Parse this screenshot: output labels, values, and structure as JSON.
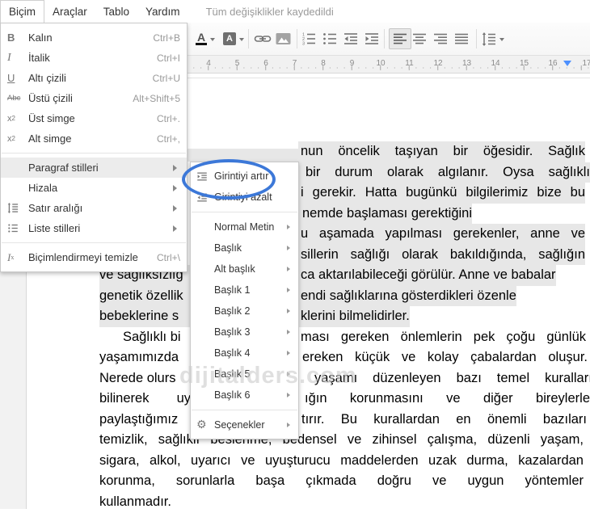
{
  "menubar": {
    "items": [
      {
        "label": "Biçim",
        "state": "open"
      },
      {
        "label": "Araçlar",
        "state": "closed"
      },
      {
        "label": "Tablo",
        "state": "closed"
      },
      {
        "label": "Yardım",
        "state": "closed"
      }
    ],
    "status": "Tüm değişiklikler kaydedildi"
  },
  "toolbar": {
    "text_color_letter": "A",
    "highlight_letter": "A",
    "icons": [
      "text-color-icon",
      "highlight-color-icon",
      "link-icon",
      "image-icon",
      "numbered-list-icon",
      "bulleted-list-icon",
      "decrease-indent-icon",
      "increase-indent-icon",
      "align-left-icon",
      "align-center-icon",
      "align-right-icon",
      "justify-icon",
      "line-spacing-icon"
    ],
    "active_button": "align-left"
  },
  "ruler": {
    "numbers": [
      "4",
      "5",
      "6",
      "7",
      "8",
      "9",
      "10",
      "11",
      "12",
      "13",
      "14",
      "15",
      "16",
      "17"
    ],
    "marker_color": "#4d90fe"
  },
  "format_menu": {
    "items": [
      {
        "label": "Kalın",
        "shortcut": "Ctrl+B",
        "icon": "bold-icon",
        "icon_glyph": "B"
      },
      {
        "label": "İtalik",
        "shortcut": "Ctrl+I",
        "icon": "italic-icon",
        "icon_glyph": "I"
      },
      {
        "label": "Altı çizili",
        "shortcut": "Ctrl+U",
        "icon": "underline-icon",
        "icon_glyph": "U"
      },
      {
        "label": "Üstü çizili",
        "shortcut": "Alt+Shift+5",
        "icon": "strikethrough-icon",
        "icon_glyph": "Abc"
      },
      {
        "label": "Üst simge",
        "shortcut": "Ctrl+.",
        "icon": "superscript-icon",
        "icon_glyph": "x"
      },
      {
        "label": "Alt simge",
        "shortcut": "Ctrl+,",
        "icon": "subscript-icon",
        "icon_glyph": "x"
      },
      {
        "label": "Paragraf stilleri",
        "has_submenu": true,
        "highlighted": true
      },
      {
        "label": "Hizala",
        "has_submenu": true
      },
      {
        "label": "Satır aralığı",
        "has_submenu": true,
        "icon": "line-spacing-icon"
      },
      {
        "label": "Liste stilleri",
        "has_submenu": true,
        "icon": "list-icon"
      },
      {
        "label": "Biçimlendirmeyi temizle",
        "shortcut": "Ctrl+\\",
        "icon": "clear-formatting-icon",
        "icon_glyph": "I"
      }
    ]
  },
  "styles_submenu": {
    "items": [
      {
        "label": "Girintiyi artır",
        "icon": "increase-indent-icon",
        "annotated": true
      },
      {
        "label": "Girintiyi azalt",
        "icon": "decrease-indent-icon"
      },
      {
        "label": "Normal Metin",
        "has_submenu": true
      },
      {
        "label": "Başlık",
        "has_submenu": true
      },
      {
        "label": "Alt başlık",
        "has_submenu": true
      },
      {
        "label": "Başlık 1",
        "has_submenu": true
      },
      {
        "label": "Başlık 2",
        "has_submenu": true
      },
      {
        "label": "Başlık 3",
        "has_submenu": true
      },
      {
        "label": "Başlık 4",
        "has_submenu": true
      },
      {
        "label": "Başlık 5",
        "has_submenu": true
      },
      {
        "label": "Başlık 6",
        "has_submenu": true
      },
      {
        "label": "Seçenekler",
        "has_submenu": true,
        "icon": "gear-icon"
      }
    ],
    "annotation": {
      "shape": "ellipse",
      "color": "#3c78d8",
      "around": "Girintiyi artır"
    }
  },
  "document": {
    "selection_color": "#e7e7e7",
    "watermark": "dijitalders.com",
    "lines": [
      {
        "right": "nun öncelik taşıyan bir öğesidir. Sağlık",
        "highlighted": true
      },
      {
        "right": "bir durum olarak algılanır. Oysa sağlıklı",
        "highlighted": true
      },
      {
        "right": "i gerekir. Hatta bugünkü bilgilerimiz bize bu",
        "highlighted": true
      },
      {
        "right": "nemde başlaması gerektiğini",
        "highlighted": true
      },
      {
        "right": "u aşamada yapılması gerekenler, anne ve",
        "highlighted": true
      },
      {
        "right": "sillerin sağlığı olarak bakıldığında, sağlığın",
        "highlighted": true
      },
      {
        "left": "ve sağlıksızlığ",
        "right": "ca aktarılabileceği görülür. Anne ve babalar",
        "highlighted": true
      },
      {
        "left": "genetik özellik",
        "right": "endi sağlıklarına gösterdikleri özenle",
        "highlighted": true
      },
      {
        "left": "bebeklerine s",
        "right": "klerini bilmelidirler.",
        "highlighted": true
      },
      {
        "left": "Sağlıklı bi",
        "right": "ması gereken önlemlerin pek çoğu günlük",
        "highlighted": false
      },
      {
        "left": "yaşamımızda",
        "right": "ereken küçük ve kolay çabalardan oluşur.",
        "highlighted": false
      },
      {
        "left": "Nerede olurs",
        "right": "yaşamı düzenleyen bazı temel kuralların",
        "highlighted": false
      },
      {
        "left": "bilinerek uy",
        "right": "ığın korunmasını ve diğer bireylerle",
        "highlighted": false
      },
      {
        "left": "paylaştığımız",
        "right": "tırır. Bu kurallardan en önemli bazıları",
        "highlighted": false
      },
      {
        "text": "temizlik, sağlıklı beslenme, bedensel ve zihinsel çalışma, düzenli yaşam,",
        "highlighted": false
      },
      {
        "text": "sigara, alkol, uyarıcı ve uyuşturucu maddelerden uzak durma, kazalardan",
        "highlighted": false
      },
      {
        "text": "korunma, sorunlarla başa çıkmada doğru ve uygun yöntemler",
        "highlighted": false
      },
      {
        "text": "kullanmadır.",
        "highlighted": false
      }
    ]
  }
}
